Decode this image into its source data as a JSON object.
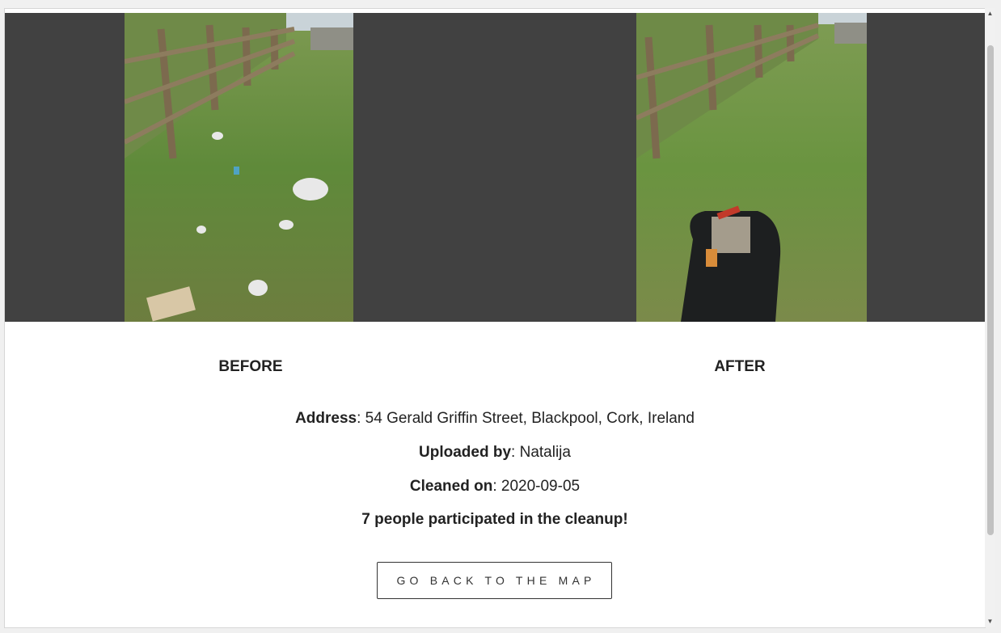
{
  "gallery": {
    "before_label": "BEFORE",
    "after_label": "AFTER"
  },
  "details": {
    "address_label": "Address",
    "address_value": ": 54 Gerald Griffin Street, Blackpool, Cork, Ireland",
    "uploader_label": "Uploaded by",
    "uploader_value": ": Natalija",
    "cleaned_label": "Cleaned on",
    "cleaned_value": ": 2020-09-05",
    "participants": "7 people participated in the cleanup!"
  },
  "actions": {
    "back_label": "GO BACK TO THE MAP"
  },
  "scrollbar": {
    "up_icon": "scroll-up-arrow-icon",
    "down_icon": "scroll-down-arrow-icon"
  }
}
